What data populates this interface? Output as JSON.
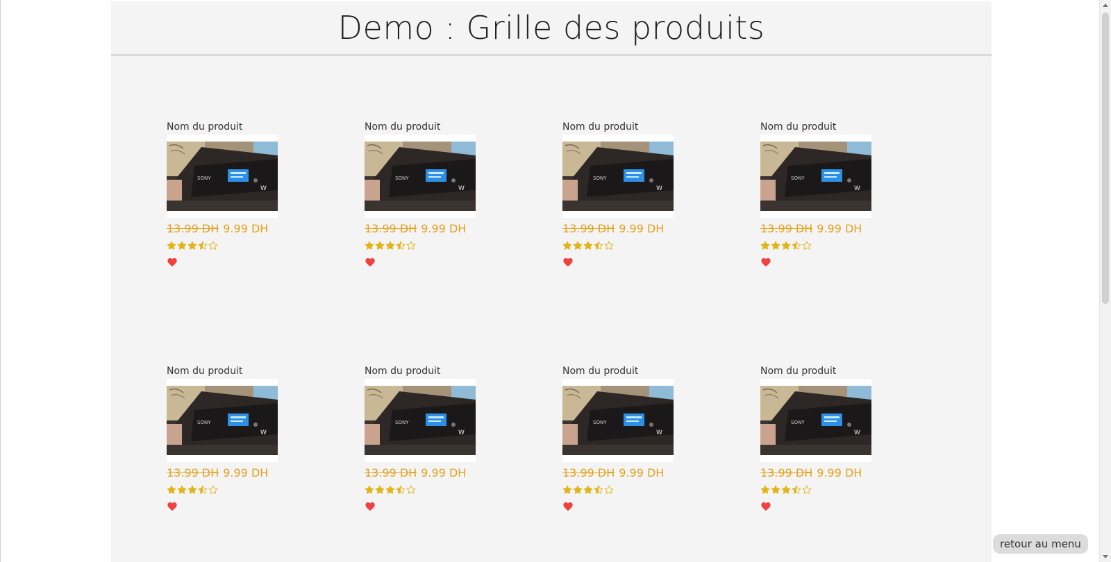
{
  "header": {
    "title": "Demo : Grille des produits"
  },
  "colors": {
    "price": "#e4a11b",
    "star": "#e2b418",
    "heart": "#f04141",
    "panel": "#f4f4f4"
  },
  "icons": {
    "rating": "star-icon",
    "favorite": "heart-icon",
    "product": "mp3-player-photo"
  },
  "products": [
    {
      "name": "Nom du produit",
      "old_price": "13.99 DH",
      "price": "9.99 DH",
      "rating": 3.5,
      "rating_max": 5
    },
    {
      "name": "Nom du produit",
      "old_price": "13.99 DH",
      "price": "9.99 DH",
      "rating": 3.5,
      "rating_max": 5
    },
    {
      "name": "Nom du produit",
      "old_price": "13.99 DH",
      "price": "9.99 DH",
      "rating": 3.5,
      "rating_max": 5
    },
    {
      "name": "Nom du produit",
      "old_price": "13.99 DH",
      "price": "9.99 DH",
      "rating": 3.5,
      "rating_max": 5
    },
    {
      "name": "Nom du produit",
      "old_price": "13.99 DH",
      "price": "9.99 DH",
      "rating": 3.5,
      "rating_max": 5
    },
    {
      "name": "Nom du produit",
      "old_price": "13.99 DH",
      "price": "9.99 DH",
      "rating": 3.5,
      "rating_max": 5
    },
    {
      "name": "Nom du produit",
      "old_price": "13.99 DH",
      "price": "9.99 DH",
      "rating": 3.5,
      "rating_max": 5
    },
    {
      "name": "Nom du produit",
      "old_price": "13.99 DH",
      "price": "9.99 DH",
      "rating": 3.5,
      "rating_max": 5
    }
  ],
  "footer": {
    "back_label": "retour au menu"
  }
}
